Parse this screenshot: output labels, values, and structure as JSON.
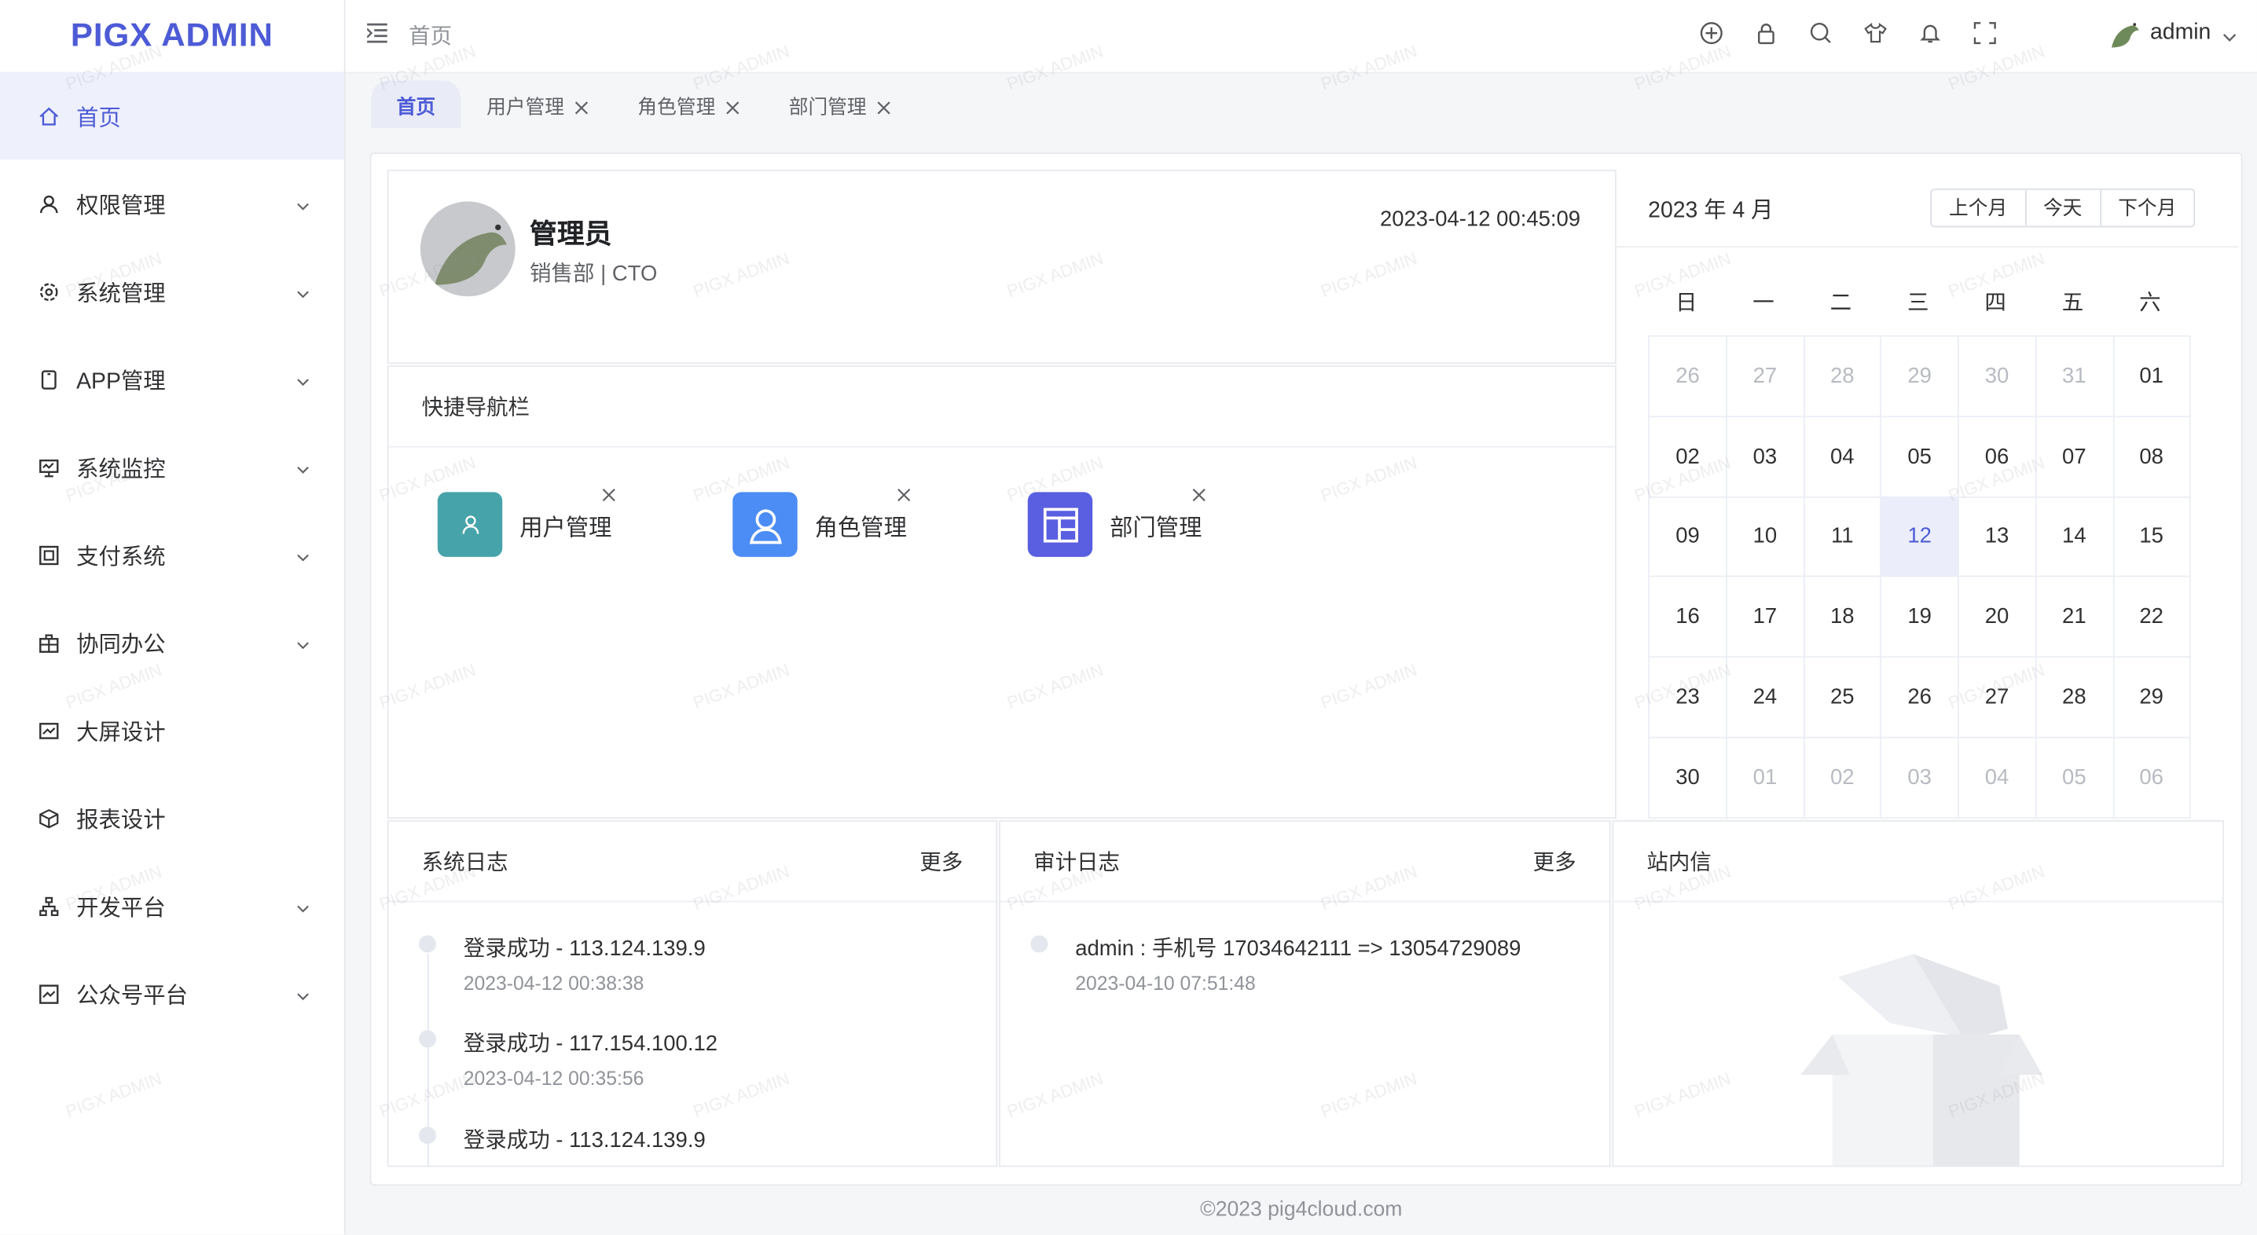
{
  "app": {
    "logo": "PIGX ADMIN",
    "watermark": "PIGX ADMIN",
    "accent": "#4d5bd6"
  },
  "sidebar": {
    "items": [
      {
        "label": "首页",
        "icon": "home-icon",
        "active": true
      },
      {
        "label": "权限管理",
        "icon": "user-icon",
        "expandable": true
      },
      {
        "label": "系统管理",
        "icon": "gear-icon",
        "expandable": true
      },
      {
        "label": "APP管理",
        "icon": "mobile-icon",
        "expandable": true
      },
      {
        "label": "系统监控",
        "icon": "monitor-icon",
        "expandable": true
      },
      {
        "label": "支付系统",
        "icon": "payment-icon",
        "expandable": true
      },
      {
        "label": "协同办公",
        "icon": "office-icon",
        "expandable": true
      },
      {
        "label": "大屏设计",
        "icon": "dashboard-icon"
      },
      {
        "label": "报表设计",
        "icon": "cube-icon"
      },
      {
        "label": "开发平台",
        "icon": "sitemap-icon",
        "expandable": true
      },
      {
        "label": "公众号平台",
        "icon": "chart-icon",
        "expandable": true
      }
    ]
  },
  "header": {
    "breadcrumb": "首页",
    "icons": [
      "globe-icon",
      "lock-icon",
      "search-icon",
      "shirt-icon",
      "bell-icon",
      "fullscreen-icon"
    ],
    "username": "admin"
  },
  "tabs": [
    {
      "label": "首页",
      "active": true
    },
    {
      "label": "用户管理"
    },
    {
      "label": "角色管理"
    },
    {
      "label": "部门管理"
    }
  ],
  "profile": {
    "name": "管理员",
    "dept": "销售部 | CTO",
    "datetime": "2023-04-12 00:45:09"
  },
  "quicknav": {
    "title": "快捷导航栏",
    "items": [
      {
        "label": "用户管理",
        "icon": "user-icon",
        "color": "#46a3a9"
      },
      {
        "label": "角色管理",
        "icon": "avatar-icon",
        "color": "#4b8cf5"
      },
      {
        "label": "部门管理",
        "icon": "layout-icon",
        "color": "#5a5ee0"
      }
    ]
  },
  "calendar": {
    "title": "2023 年 4 月",
    "buttons": [
      "上个月",
      "今天",
      "下个月"
    ],
    "weekdays": [
      "日",
      "一",
      "二",
      "三",
      "四",
      "五",
      "六"
    ],
    "days": [
      "26",
      "27",
      "28",
      "29",
      "30",
      "31",
      "01",
      "02",
      "03",
      "04",
      "05",
      "06",
      "07",
      "08",
      "09",
      "10",
      "11",
      "12",
      "13",
      "14",
      "15",
      "16",
      "17",
      "18",
      "19",
      "20",
      "21",
      "22",
      "23",
      "24",
      "25",
      "26",
      "27",
      "28",
      "29",
      "30",
      "01",
      "02",
      "03",
      "04",
      "05",
      "06"
    ],
    "today_index": 17,
    "current_month_range": [
      6,
      35
    ]
  },
  "syslog": {
    "title": "系统日志",
    "more": "更多",
    "items": [
      {
        "text": "登录成功 - 113.124.139.9",
        "time": "2023-04-12 00:38:38"
      },
      {
        "text": "登录成功 - 117.154.100.12",
        "time": "2023-04-12 00:35:56"
      },
      {
        "text": "登录成功 - 113.124.139.9",
        "time": ""
      }
    ]
  },
  "auditlog": {
    "title": "审计日志",
    "more": "更多",
    "items": [
      {
        "text": "admin : 手机号 17034642111 => 13054729089",
        "time": "2023-04-10 07:51:48"
      }
    ]
  },
  "messages": {
    "title": "站内信",
    "icon": "empty-box-icon"
  },
  "footer": "©2023 pig4cloud.com"
}
